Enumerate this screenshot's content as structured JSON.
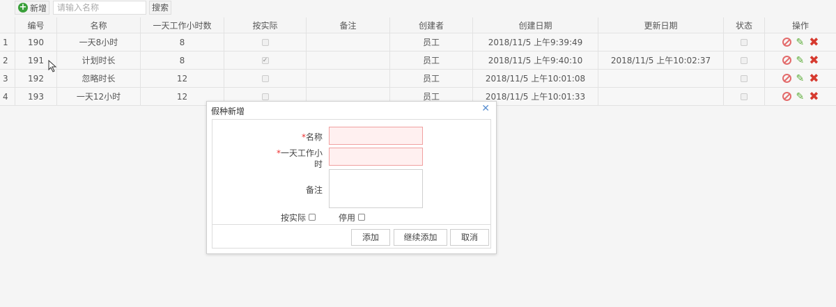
{
  "toolbar": {
    "add_label": "新增",
    "search_placeholder": "请输入名称",
    "search_label": "搜索"
  },
  "table": {
    "headers": {
      "id": "编号",
      "name": "名称",
      "hours": "一天工作小时数",
      "actual": "按实际",
      "remark": "备注",
      "creator": "创建者",
      "created": "创建日期",
      "updated": "更新日期",
      "status": "状态",
      "ops": "操作"
    },
    "rows": [
      {
        "num": "1",
        "id": "190",
        "name": "一天8小时",
        "hours": "8",
        "actual": false,
        "remark": "",
        "creator": "员工",
        "created": "2018/11/5 上午9:39:49",
        "updated": "",
        "status": false
      },
      {
        "num": "2",
        "id": "191",
        "name": "计划时长",
        "hours": "8",
        "actual": true,
        "remark": "",
        "creator": "员工",
        "created": "2018/11/5 上午9:40:10",
        "updated": "2018/11/5 上午10:02:37",
        "status": false
      },
      {
        "num": "3",
        "id": "192",
        "name": "忽略时长",
        "hours": "12",
        "actual": false,
        "remark": "",
        "creator": "员工",
        "created": "2018/11/5 上午10:01:08",
        "updated": "",
        "status": false
      },
      {
        "num": "4",
        "id": "193",
        "name": "一天12小时",
        "hours": "12",
        "actual": false,
        "remark": "",
        "creator": "员工",
        "created": "2018/11/5 上午10:01:33",
        "updated": "",
        "status": false
      }
    ]
  },
  "dialog": {
    "title": "假种新增",
    "required_mark": "*",
    "name_label": "名称",
    "hours_label_line1": "一天工作小",
    "hours_label_line2": "时",
    "remark_label": "备注",
    "actual_label": "按实际",
    "disabled_label": "停用",
    "add_label": "添加",
    "continue_label": "继续添加",
    "cancel_label": "取消"
  },
  "icons": {
    "add": "plus-circle-icon",
    "disable": "ban-icon",
    "edit": "pencil-icon",
    "delete": "x-icon",
    "close": "close-icon"
  },
  "colors": {
    "add_icon": "#3aa03a",
    "disable_icon": "#e36a6a",
    "edit_icon": "#5fae3c",
    "delete_icon": "#d63a2f",
    "required_field_bg": "#fff0f0",
    "required_field_border": "#f0a0a0",
    "close_icon": "#5a8fd0"
  }
}
